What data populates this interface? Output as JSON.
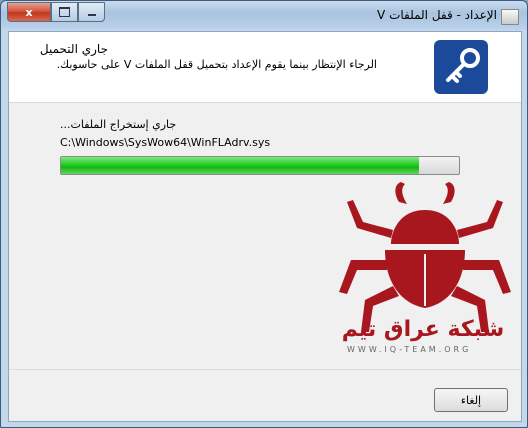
{
  "window": {
    "title": "الإعداد - قفل الملفات V",
    "close_glyph": "x"
  },
  "header": {
    "title": "جاري التحميل",
    "subtitle": "الرجاء الإنتظار بينما يقوم الإعداد بتحميل قفل الملفات V على حاسوبك."
  },
  "status": {
    "label": "جاري إستخراج الملفات...",
    "file_path": "C:\\Windows\\SysWow64\\WinFLAdrv.sys"
  },
  "progress": {
    "percent": 90
  },
  "watermark": {
    "name": "شبكة عراق تيم",
    "url": "WWW.IQ-TEAM.ORG"
  },
  "buttons": {
    "cancel_label": "إلغاء"
  },
  "colors": {
    "accent": "#1b4a9a",
    "progress": "#1fc21f",
    "watermark": "#a8161e"
  }
}
